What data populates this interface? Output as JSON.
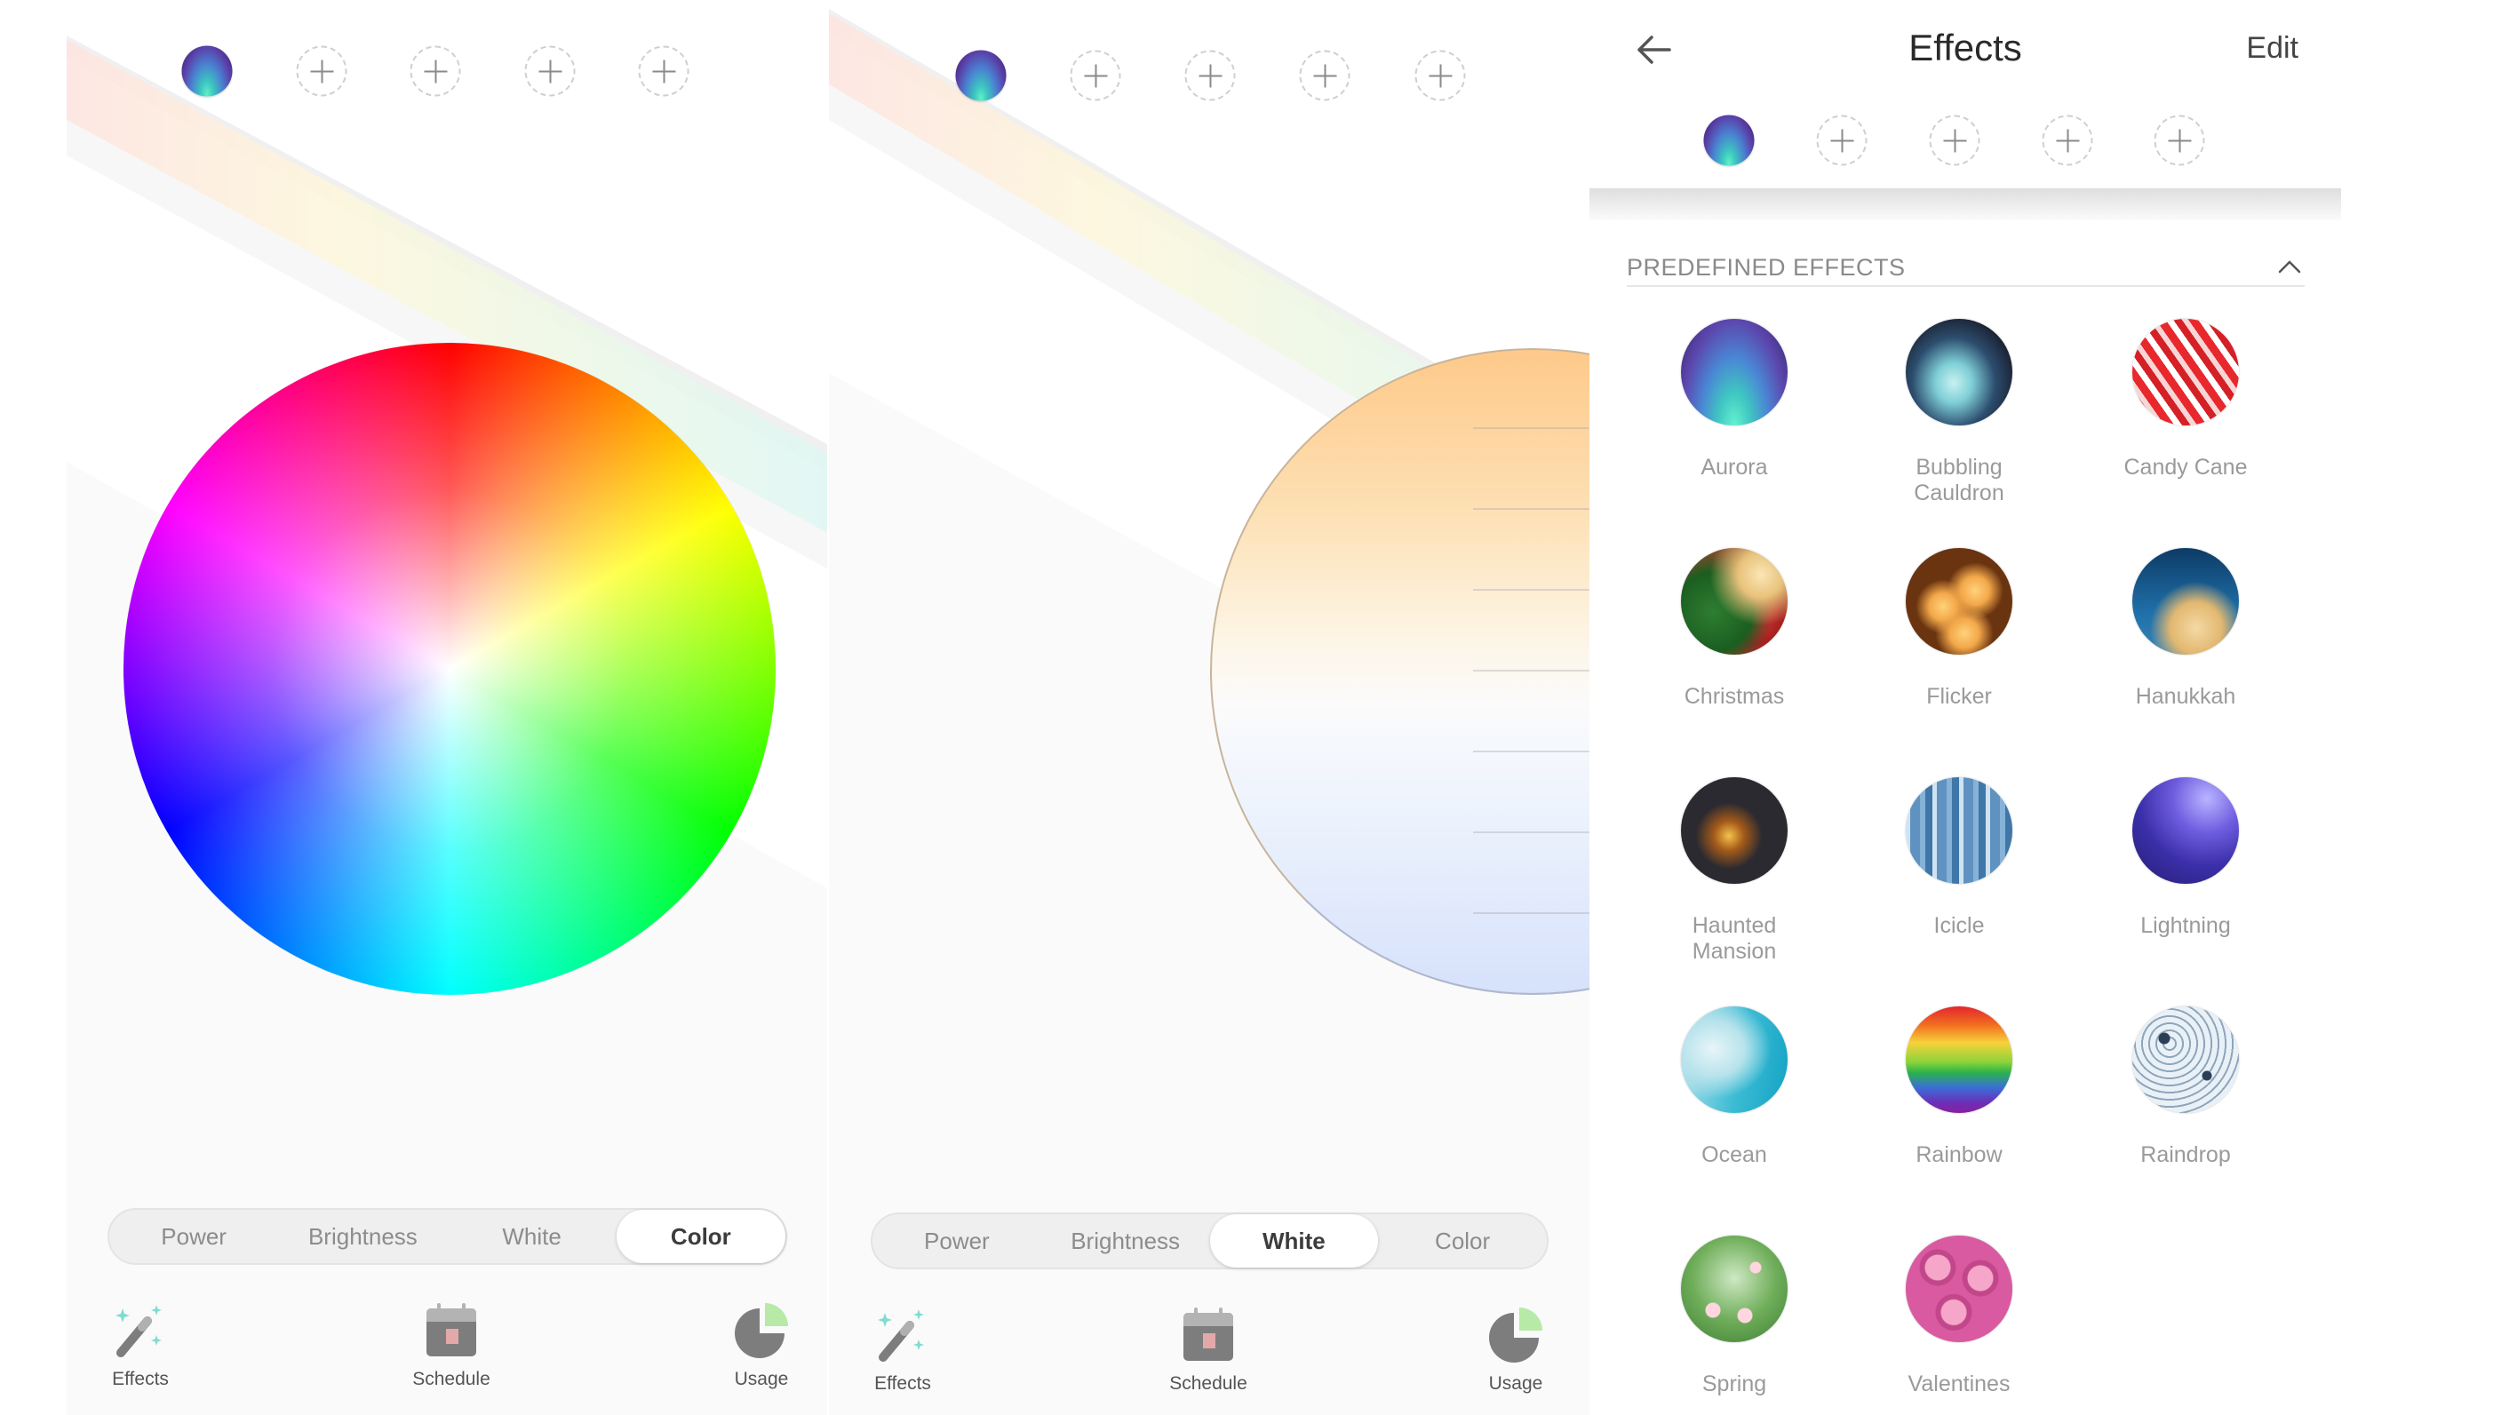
{
  "screens": {
    "color": {
      "quick_slots": [
        {
          "state": "filled",
          "effect": "Aurora"
        },
        {
          "state": "empty",
          "icon": "plus-icon"
        },
        {
          "state": "empty",
          "icon": "plus-icon"
        },
        {
          "state": "empty",
          "icon": "plus-icon"
        },
        {
          "state": "empty",
          "icon": "plus-icon"
        }
      ],
      "picker": "color-wheel",
      "tabs": [
        "Power",
        "Brightness",
        "White",
        "Color"
      ],
      "active_tab": "Color",
      "nav": [
        {
          "label": "Effects",
          "icon": "magic-wand-icon"
        },
        {
          "label": "Schedule",
          "icon": "calendar-icon"
        },
        {
          "label": "Usage",
          "icon": "pie-chart-icon"
        }
      ]
    },
    "white": {
      "quick_slots": [
        {
          "state": "filled",
          "effect": "Aurora"
        },
        {
          "state": "empty",
          "icon": "plus-icon"
        },
        {
          "state": "empty",
          "icon": "plus-icon"
        },
        {
          "state": "empty",
          "icon": "plus-icon"
        },
        {
          "state": "empty",
          "icon": "plus-icon"
        }
      ],
      "picker": "white-temperature-wheel",
      "tabs": [
        "Power",
        "Brightness",
        "White",
        "Color"
      ],
      "active_tab": "White",
      "nav": [
        {
          "label": "Effects",
          "icon": "magic-wand-icon"
        },
        {
          "label": "Schedule",
          "icon": "calendar-icon"
        },
        {
          "label": "Usage",
          "icon": "pie-chart-icon"
        }
      ]
    },
    "effects": {
      "header": {
        "title": "Effects",
        "back_icon": "arrow-left-icon",
        "edit_label": "Edit"
      },
      "quick_slots": [
        {
          "state": "filled",
          "effect": "Aurora"
        },
        {
          "state": "empty",
          "icon": "plus-icon"
        },
        {
          "state": "empty",
          "icon": "plus-icon"
        },
        {
          "state": "empty",
          "icon": "plus-icon"
        },
        {
          "state": "empty",
          "icon": "plus-icon"
        }
      ],
      "section": {
        "title": "PREDEFINED EFFECTS",
        "expanded": true,
        "toggle_icon": "chevron-up-icon"
      },
      "effects": [
        {
          "label": "Aurora",
          "thumb": "aurora"
        },
        {
          "label": "Bubbling\nCauldron",
          "thumb": "cauldron"
        },
        {
          "label": "Candy Cane",
          "thumb": "candy"
        },
        {
          "label": "Christmas",
          "thumb": "christmas"
        },
        {
          "label": "Flicker",
          "thumb": "flicker"
        },
        {
          "label": "Hanukkah",
          "thumb": "hanukkah"
        },
        {
          "label": "Haunted\nMansion",
          "thumb": "haunted"
        },
        {
          "label": "Icicle",
          "thumb": "icicle"
        },
        {
          "label": "Lightning",
          "thumb": "lightning"
        },
        {
          "label": "Ocean",
          "thumb": "ocean"
        },
        {
          "label": "Rainbow",
          "thumb": "rainbow"
        },
        {
          "label": "Raindrop",
          "thumb": "raindrop"
        },
        {
          "label": "Spring",
          "thumb": "spring"
        },
        {
          "label": "Valentines",
          "thumb": "valentines"
        }
      ]
    }
  },
  "colors": {
    "accent_teal": "#7fdcd2",
    "icon_gray": "#7d7d7d",
    "usage_green": "#b6eaa6",
    "schedule_pink": "#e3a9a9"
  }
}
